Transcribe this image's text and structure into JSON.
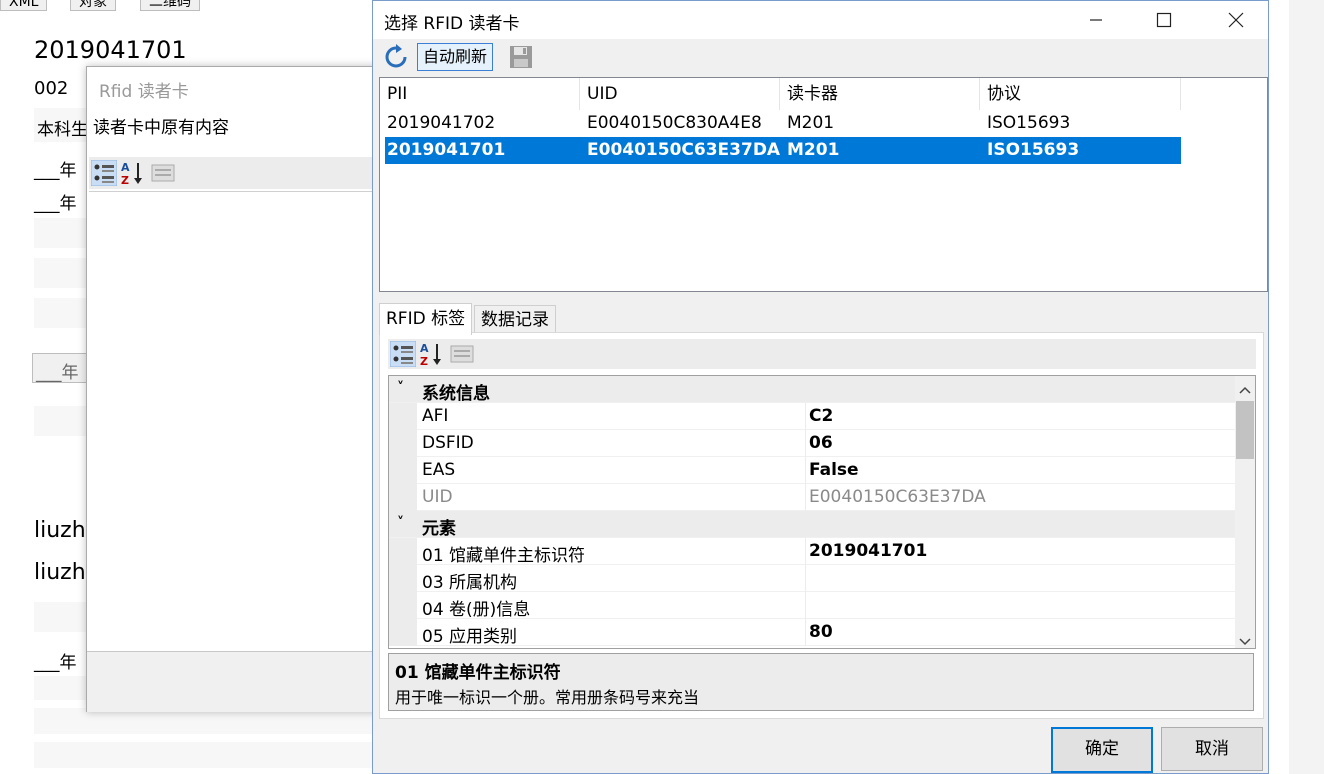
{
  "background_form": {
    "tabs": [
      "XML",
      "对象",
      "二维码"
    ],
    "barcode": "2019041701",
    "code": "002",
    "category_prefix": "本科生",
    "year_fields": [
      "___年",
      "___年",
      "___年",
      "___年"
    ],
    "names": [
      "liuzh",
      "liuzh"
    ]
  },
  "mid_dialog": {
    "title": "Rfid 读者卡",
    "content_label": "读者卡中原有内容"
  },
  "main_dialog": {
    "title": "选择 RFID 读者卡",
    "toolbar": {
      "auto_refresh": "自动刷新"
    },
    "grid": {
      "columns": [
        "PII",
        "UID",
        "读卡器",
        "协议"
      ],
      "rows": [
        {
          "pii": "2019041702",
          "uid": "E0040150C830A4E8",
          "reader": "M201",
          "protocol": "ISO15693",
          "selected": false
        },
        {
          "pii": "2019041701",
          "uid": "E0040150C63E37DA",
          "reader": "M201",
          "protocol": "ISO15693",
          "selected": true
        }
      ]
    },
    "tabs": [
      "RFID 标签",
      "数据记录"
    ],
    "property_grid": {
      "categories": [
        {
          "name": "系统信息",
          "items": [
            {
              "name": "AFI",
              "value": "C2",
              "readonly": false
            },
            {
              "name": "DSFID",
              "value": "06",
              "readonly": false
            },
            {
              "name": "EAS",
              "value": "False",
              "readonly": false
            },
            {
              "name": "UID",
              "value": "E0040150C63E37DA",
              "readonly": true
            }
          ]
        },
        {
          "name": "元素",
          "items": [
            {
              "name": "01 馆藏单件主标识符",
              "value": "2019041701",
              "readonly": false
            },
            {
              "name": "03 所属机构",
              "value": "",
              "readonly": false
            },
            {
              "name": "04 卷(册)信息",
              "value": "",
              "readonly": false
            },
            {
              "name": "05 应用类别",
              "value": "80",
              "readonly": false
            }
          ]
        }
      ]
    },
    "description": {
      "title": "01 馆藏单件主标识符",
      "text": "用于唯一标识一个册。常用册条码号来充当"
    },
    "buttons": {
      "ok": "确定",
      "cancel": "取消"
    }
  },
  "colors": {
    "selection": "#0078d7",
    "accent": "#2a6ebb"
  }
}
